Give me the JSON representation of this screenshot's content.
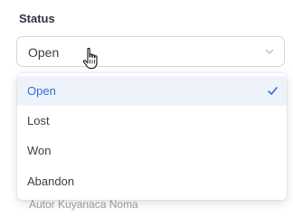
{
  "status_field": {
    "label": "Status",
    "selected_value": "Open",
    "chevron_icon": "chevron-down-icon",
    "cursor_icon": "hand-pointer-icon"
  },
  "dropdown": {
    "options": [
      {
        "label": "Open",
        "selected": true
      },
      {
        "label": "Lost",
        "selected": false
      },
      {
        "label": "Won",
        "selected": false
      },
      {
        "label": "Abandon",
        "selected": false
      }
    ],
    "selected_icon": "checkmark-icon",
    "accent_color": "#2f6fd6"
  },
  "background": {
    "partial_label": "Autor Kuyanaca Noma"
  }
}
